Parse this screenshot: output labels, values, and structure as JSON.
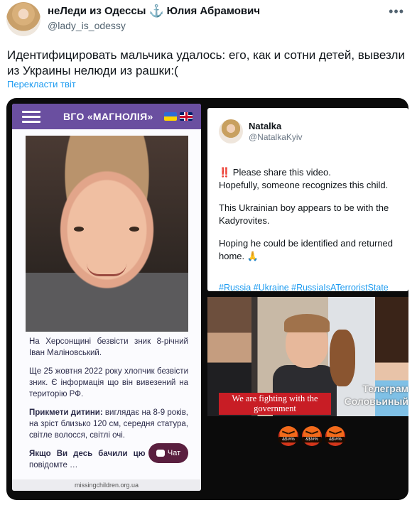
{
  "tweet": {
    "author_name": "неЛеди из Одессы",
    "anchor_glyph": "⚓",
    "author_name_2": "Юлия Абрамович",
    "handle": "@lady_is_odessy",
    "more": "•••",
    "text": "Идентифицировать мальчика удалось: его, как и сотни детей, вывезли из Украины нелюди из рашки:(",
    "translate_link": "Перекласти твіт"
  },
  "left_screenshot": {
    "site_title": "ВГО «МАГНОЛІЯ»",
    "p1": "На Херсонщині безвісти зник 8-річний Іван Маліновський.",
    "p2": "Ще 25 жовтня 2022 року хлопчик безвісти зник. Є інформація що він вивезений на територію РФ.",
    "p3_bold": "Прикмети дитини:",
    "p3_rest": " виглядає на 8-9 років, на зріст близько 120 см, середня статура, світле волосся, світлі очі.",
    "p4_bold": "Якщо Ви десь бачили цю дитину -",
    "p4_rest": " повідомте …",
    "chat_label": "Чат",
    "url": "missingchildren.org.ua"
  },
  "embedded_tweet": {
    "name": "Natalka",
    "handle": "@NatalkaKyiv",
    "bang": "‼️",
    "line1": " Please share this video.",
    "line2": "Hopefully, someone recognizes this child.",
    "line3": "This Ukrainian boy appears to be with the Kadyrovites.",
    "line4": "Hoping he could be identified and returned home. 🙏",
    "hashtags": "#Russia #Ukraine #RussiaIsATerroristState"
  },
  "video": {
    "caption": "We are fighting with the government",
    "watermark": "Телеграм Соловьиный"
  },
  "reactions": {
    "symbol": "&$!#%",
    "count": 3
  },
  "colors": {
    "link": "#1d9bf0",
    "site_nav": "#6a4fa0",
    "caption_bg": "#c81d25"
  }
}
